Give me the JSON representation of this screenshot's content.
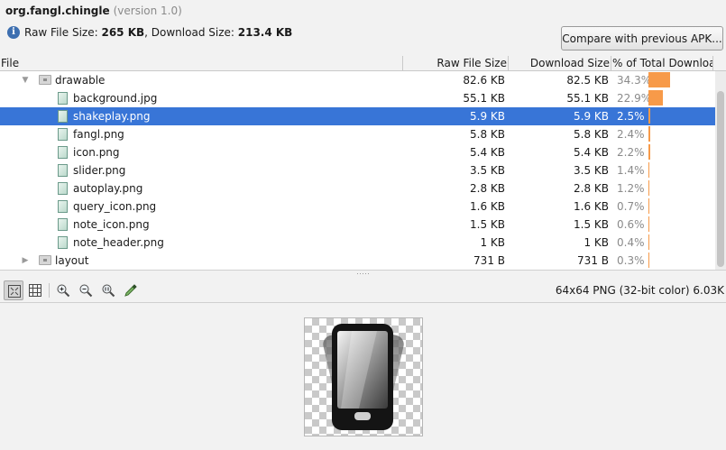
{
  "header": {
    "package": "org.fangl.chingle",
    "version": "(version 1.0)",
    "raw_label": "Raw File Size:",
    "raw_value": "265 KB",
    "dl_label": "Download Size:",
    "dl_value": "213.4 KB",
    "compare_button": "Compare with previous APK..."
  },
  "columns": {
    "file": "File",
    "raw": "Raw File Size",
    "download": "Download Size",
    "percent": "% of Total Downloa..."
  },
  "accent_color": "#f79a49",
  "selection_color": "#3875d7",
  "rows": [
    {
      "name": "drawable",
      "kind": "folder",
      "expanded": true,
      "raw": "82.6 KB",
      "dl": "82.5 KB",
      "pct": "34.3%",
      "share": 34.3
    },
    {
      "name": "background.jpg",
      "kind": "file",
      "raw": "55.1 KB",
      "dl": "55.1 KB",
      "pct": "22.9%",
      "share": 22.9
    },
    {
      "name": "shakeplay.png",
      "kind": "file",
      "selected": true,
      "raw": "5.9 KB",
      "dl": "5.9 KB",
      "pct": "2.5%",
      "share": 2.5
    },
    {
      "name": "fangl.png",
      "kind": "file",
      "raw": "5.8 KB",
      "dl": "5.8 KB",
      "pct": "2.4%",
      "share": 2.4
    },
    {
      "name": "icon.png",
      "kind": "file",
      "raw": "5.4 KB",
      "dl": "5.4 KB",
      "pct": "2.2%",
      "share": 2.2
    },
    {
      "name": "slider.png",
      "kind": "file",
      "raw": "3.5 KB",
      "dl": "3.5 KB",
      "pct": "1.4%",
      "share": 1.4
    },
    {
      "name": "autoplay.png",
      "kind": "file",
      "raw": "2.8 KB",
      "dl": "2.8 KB",
      "pct": "1.2%",
      "share": 1.2
    },
    {
      "name": "query_icon.png",
      "kind": "file",
      "raw": "1.6 KB",
      "dl": "1.6 KB",
      "pct": "0.7%",
      "share": 0.7
    },
    {
      "name": "note_icon.png",
      "kind": "file",
      "raw": "1.5 KB",
      "dl": "1.5 KB",
      "pct": "0.6%",
      "share": 0.6
    },
    {
      "name": "note_header.png",
      "kind": "file",
      "raw": "1 KB",
      "dl": "1 KB",
      "pct": "0.4%",
      "share": 0.4
    },
    {
      "name": "layout",
      "kind": "folder",
      "expanded": false,
      "raw": "731 B",
      "dl": "731 B",
      "pct": "0.3%",
      "share": 0.3
    }
  ],
  "toolbar": {
    "icons": [
      "actual-size-icon",
      "grid-icon",
      "zoom-in-icon",
      "zoom-out-icon",
      "zoom-actual-icon",
      "color-picker-icon"
    ],
    "image_info": "64x64 PNG (32-bit color) 6.03K"
  }
}
